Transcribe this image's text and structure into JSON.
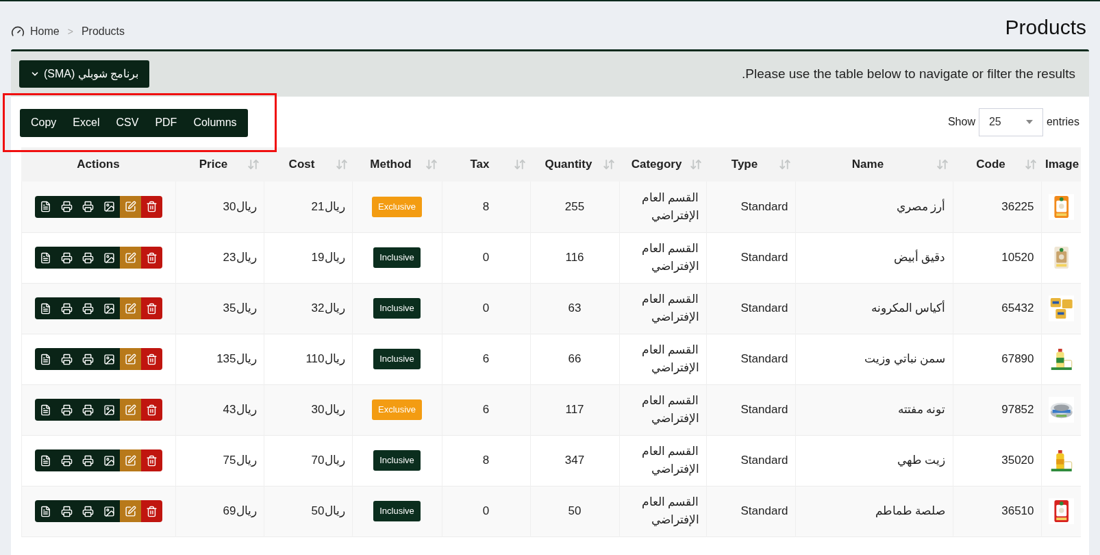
{
  "page_title": "Products",
  "breadcrumb": {
    "items": [
      {
        "label": "Products"
      },
      {
        "label": "Home"
      }
    ],
    "separator": ">"
  },
  "panel": {
    "message": ".Please use the table below to navigate or filter the results",
    "store_button": "برنامج شوبلي (SMA)"
  },
  "page_length": {
    "label_before": "Show",
    "value": "25",
    "label_after": "entries"
  },
  "export_buttons": [
    "Columns",
    "PDF",
    "CSV",
    "Excel",
    "Copy"
  ],
  "table": {
    "columns": [
      {
        "label": "Image",
        "sortable": false
      },
      {
        "label": "Code",
        "sortable": true
      },
      {
        "label": "Name",
        "sortable": true
      },
      {
        "label": "Type",
        "sortable": true
      },
      {
        "label": "Category",
        "sortable": true
      },
      {
        "label": "Quantity",
        "sortable": true
      },
      {
        "label": "Tax",
        "sortable": true
      },
      {
        "label": "Method",
        "sortable": true
      },
      {
        "label": "Cost",
        "sortable": true
      },
      {
        "label": "Price",
        "sortable": true
      },
      {
        "label": "Actions",
        "sortable": false
      }
    ],
    "rows": [
      {
        "code": "36225",
        "name": "أرز مصري",
        "type": "Standard",
        "category": "القسم العام الإفتراضي",
        "quantity": "255",
        "tax": "8",
        "method": {
          "label": "Exclusive",
          "color": "#f39c12"
        },
        "cost": "ريال21",
        "price": "ريال30"
      },
      {
        "code": "10520",
        "name": "دقيق أبيض",
        "type": "Standard",
        "category": "القسم العام الإفتراضي",
        "quantity": "116",
        "tax": "0",
        "method": {
          "label": "Inclusive",
          "color": "#0b2e1e"
        },
        "cost": "ريال19",
        "price": "ريال23"
      },
      {
        "code": "65432",
        "name": "أكياس المكرونه",
        "type": "Standard",
        "category": "القسم العام الإفتراضي",
        "quantity": "63",
        "tax": "0",
        "method": {
          "label": "Inclusive",
          "color": "#0b2e1e"
        },
        "cost": "ريال32",
        "price": "ريال35"
      },
      {
        "code": "67890",
        "name": "سمن نباتي وزيت",
        "type": "Standard",
        "category": "القسم العام الإفتراضي",
        "quantity": "66",
        "tax": "6",
        "method": {
          "label": "Inclusive",
          "color": "#0b2e1e"
        },
        "cost": "ريال110",
        "price": "ريال135"
      },
      {
        "code": "97852",
        "name": "تونه مفتته",
        "type": "Standard",
        "category": "القسم العام الإفتراضي",
        "quantity": "117",
        "tax": "6",
        "method": {
          "label": "Exclusive",
          "color": "#f39c12"
        },
        "cost": "ريال30",
        "price": "ريال43"
      },
      {
        "code": "35020",
        "name": "زيت طهي",
        "type": "Standard",
        "category": "القسم العام الإفتراضي",
        "quantity": "347",
        "tax": "8",
        "method": {
          "label": "Inclusive",
          "color": "#0b2e1e"
        },
        "cost": "ريال70",
        "price": "ريال75"
      },
      {
        "code": "36510",
        "name": "صلصة طماطم",
        "type": "Standard",
        "category": "القسم العام الإفتراضي",
        "quantity": "50",
        "tax": "0",
        "method": {
          "label": "Inclusive",
          "color": "#0b2e1e"
        },
        "cost": "ريال50",
        "price": "ريال69"
      }
    ]
  }
}
